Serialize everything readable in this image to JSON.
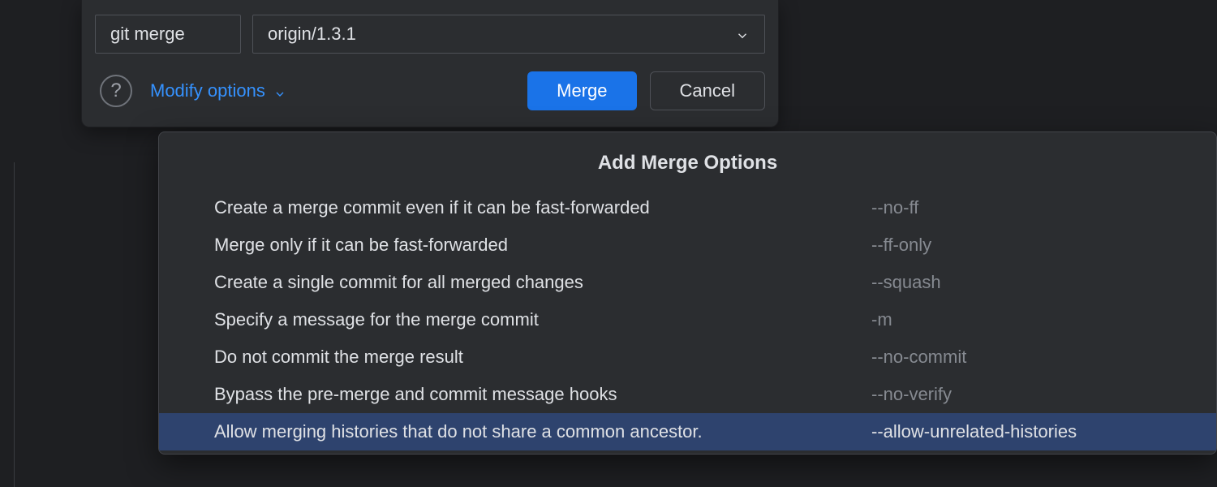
{
  "command": {
    "label": "git merge",
    "branch": "origin/1.3.1"
  },
  "toolbar": {
    "help_glyph": "?",
    "modify_options_label": "Modify options",
    "merge_label": "Merge",
    "cancel_label": "Cancel"
  },
  "popup": {
    "title": "Add Merge Options",
    "selected_index": 6,
    "options": [
      {
        "desc": "Create a merge commit even if it can be fast-forwarded",
        "flag": "--no-ff"
      },
      {
        "desc": "Merge only if it can be fast-forwarded",
        "flag": "--ff-only"
      },
      {
        "desc": "Create a single commit for all merged changes",
        "flag": "--squash"
      },
      {
        "desc": "Specify a message for the merge commit",
        "flag": "-m"
      },
      {
        "desc": "Do not commit the merge result",
        "flag": "--no-commit"
      },
      {
        "desc": "Bypass the pre-merge and commit message hooks",
        "flag": "--no-verify"
      },
      {
        "desc": "Allow merging histories that do not share a common ancestor.",
        "flag": "--allow-unrelated-histories"
      }
    ]
  }
}
